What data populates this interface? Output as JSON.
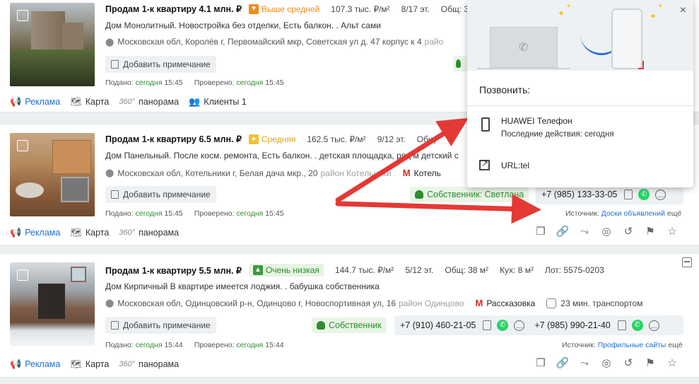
{
  "listings": [
    {
      "title": "Продам 1-к квартиру 4.1 млн. ₽",
      "rating": "Выше средней",
      "price_per_m2": "107.3 тыс. ₽/м²",
      "floor": "8/17 эт.",
      "area": "Общ: 3",
      "description": "Дом Монолитный. Новостройка без отделки, Есть балкон. . Альт сами",
      "address": "Московская обл, Королёв г, Первомайский мкр, Советская ул д. 47 корпус к 4",
      "district": "райо",
      "note_label": "Добавить примечание",
      "posted_label": "Подано:",
      "posted_day": "сегодня",
      "posted_time": "15:45",
      "checked_label": "Проверено:",
      "checked_day": "сегодня",
      "checked_time": "15:45",
      "actions": {
        "ad": "Реклама",
        "map": "Карта",
        "p360": "360°",
        "panorama": "панорама",
        "clients": "Клиенты 1"
      }
    },
    {
      "title": "Продам 1-к квартиру 6.5 млн. ₽",
      "rating": "Средняя",
      "price_per_m2": "162.5 тыс. ₽/м²",
      "floor": "9/12 эт.",
      "area": "Общ",
      "description": "Дом Панельный. После косм. ремонта, Есть балкон. . детская площадка, ряд   м детский с",
      "address": "Московская обл, Котельники г, Белая дача мкр., 20",
      "district": "район Котельники",
      "metro": "Котель",
      "note_label": "Добавить примечание",
      "owner": "Собственник: Светлана",
      "phone1": "+7 (985) 133-33-05",
      "posted_label": "Подано:",
      "posted_day": "сегодня",
      "posted_time": "15:45",
      "checked_label": "Проверено:",
      "checked_day": "сегодня",
      "checked_time": "15:45",
      "source_label": "Источник:",
      "source_link": "Доски объявлений",
      "source_more": "ещё",
      "actions": {
        "ad": "Реклама",
        "map": "Карта",
        "p360": "360°",
        "panorama": "панорама"
      }
    },
    {
      "title": "Продам 1-к квартиру 5.5 млн. ₽",
      "rating": "Очень низкая",
      "price_per_m2": "144.7 тыс. ₽/м²",
      "floor": "5/12 эт.",
      "area": "Общ: 38 м²",
      "kitchen": "Кух: 8 м²",
      "lot": "Лот: 5575-0203",
      "description": "Дом Кирпичный В квартире имеется лоджия. . бабушка собственника",
      "address": "Московская обл, Одинцовский р-н, Одинцово г, Новоспортивная ул, 16",
      "district": "район Одинцово",
      "metro": "Рассказовка",
      "transport": "23 мин. транспортом",
      "note_label": "Добавить примечание",
      "owner": "Собственник",
      "phone1": "+7 (910) 460-21-05",
      "phone2": "+7 (985) 990-21-40",
      "posted_label": "Подано:",
      "posted_day": "сегодня",
      "posted_time": "15:44",
      "checked_label": "Проверено:",
      "checked_day": "сегодня",
      "checked_time": "15:44",
      "source_label": "Источник:",
      "source_link": "Профильные сайты",
      "source_more": "ещё",
      "actions": {
        "ad": "Реклама",
        "map": "Карта",
        "p360": "360°",
        "panorama": "панорама"
      }
    }
  ],
  "popup": {
    "title": "Позвонить:",
    "device_name": "HUAWEI Телефон",
    "device_sub": "Последние действия: сегодня",
    "url_label": "URL:tel",
    "close": "×"
  },
  "colors": {
    "accent_link": "#1f6fd1",
    "owner_green": "#2e8b2e",
    "warn_orange": "#f08a1c",
    "arrow_red": "#e53935"
  },
  "icons": [
    "thumbs-down-icon",
    "thumbs-mid-icon",
    "thumbs-up-icon",
    "pin-icon",
    "note-icon",
    "owner-icon",
    "copy-icon",
    "whatsapp-icon",
    "smile-icon",
    "megaphone-icon",
    "map-icon",
    "people-icon",
    "link-icon",
    "share-icon",
    "hide-icon",
    "history-icon",
    "flag-icon",
    "star-icon",
    "phone-icon",
    "external-link-icon",
    "metro-icon",
    "bus-icon"
  ]
}
